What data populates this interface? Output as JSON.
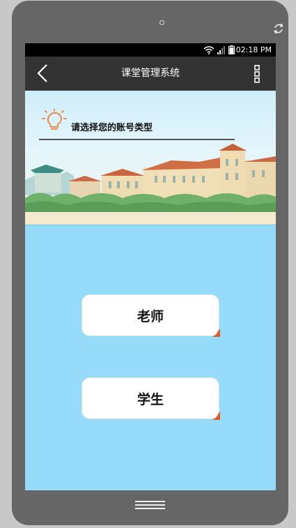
{
  "device": {
    "rotate_icon": "rotate-icon",
    "home_icon": "home-lines-icon"
  },
  "statusbar": {
    "time": "02:18 PM",
    "icons": [
      "wifi-icon",
      "signal-icon",
      "battery-icon"
    ]
  },
  "appbar": {
    "title": "课堂管理系统",
    "back_icon": "back-arrow-icon",
    "menu_icon": "overflow-menu-icon"
  },
  "banner": {
    "prompt": "请选择您的账号类型",
    "icon": "lightbulb-icon"
  },
  "roles": {
    "teacher_label": "老师",
    "student_label": "学生"
  },
  "colors": {
    "screen_bg": "#96dcfa",
    "appbar_bg": "#333333",
    "accent_orange": "#f08a4b"
  }
}
